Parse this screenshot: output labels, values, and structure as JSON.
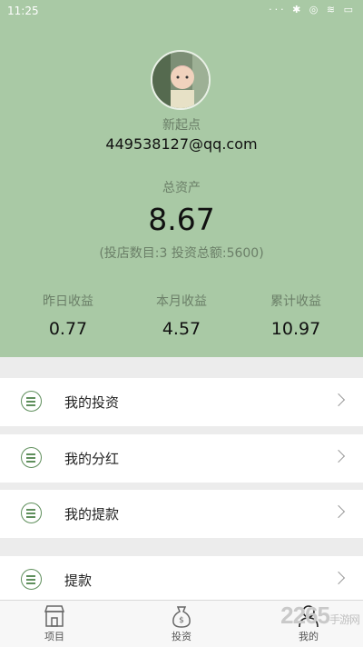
{
  "status_bar": {
    "time": "11:25",
    "icons": "··· ✱ ◎ ≋ ▭"
  },
  "profile": {
    "nickname": "新起点",
    "email": "449538127@qq.com",
    "total_assets_label": "总资产",
    "total_assets_value": "8.67",
    "assets_detail": "(投店数目:3   投资总额:5600)"
  },
  "stats": [
    {
      "label": "昨日收益",
      "value": "0.77"
    },
    {
      "label": "本月收益",
      "value": "4.57"
    },
    {
      "label": "累计收益",
      "value": "10.97"
    }
  ],
  "menu": [
    {
      "label": "我的投资",
      "icon": "list-icon"
    },
    {
      "label": "我的分红",
      "icon": "list-icon"
    },
    {
      "label": "我的提款",
      "icon": "list-icon"
    },
    {
      "label": "提款",
      "icon": "list-icon"
    }
  ],
  "tabs": [
    {
      "label": "项目",
      "icon": "store-icon"
    },
    {
      "label": "投资",
      "icon": "money-bag-icon"
    },
    {
      "label": "我的",
      "icon": "user-icon"
    }
  ],
  "watermark": {
    "text": "2265",
    "sub": "手游网"
  },
  "colors": {
    "header_bg": "#a9c9a5",
    "accent": "#5f8f5c"
  }
}
